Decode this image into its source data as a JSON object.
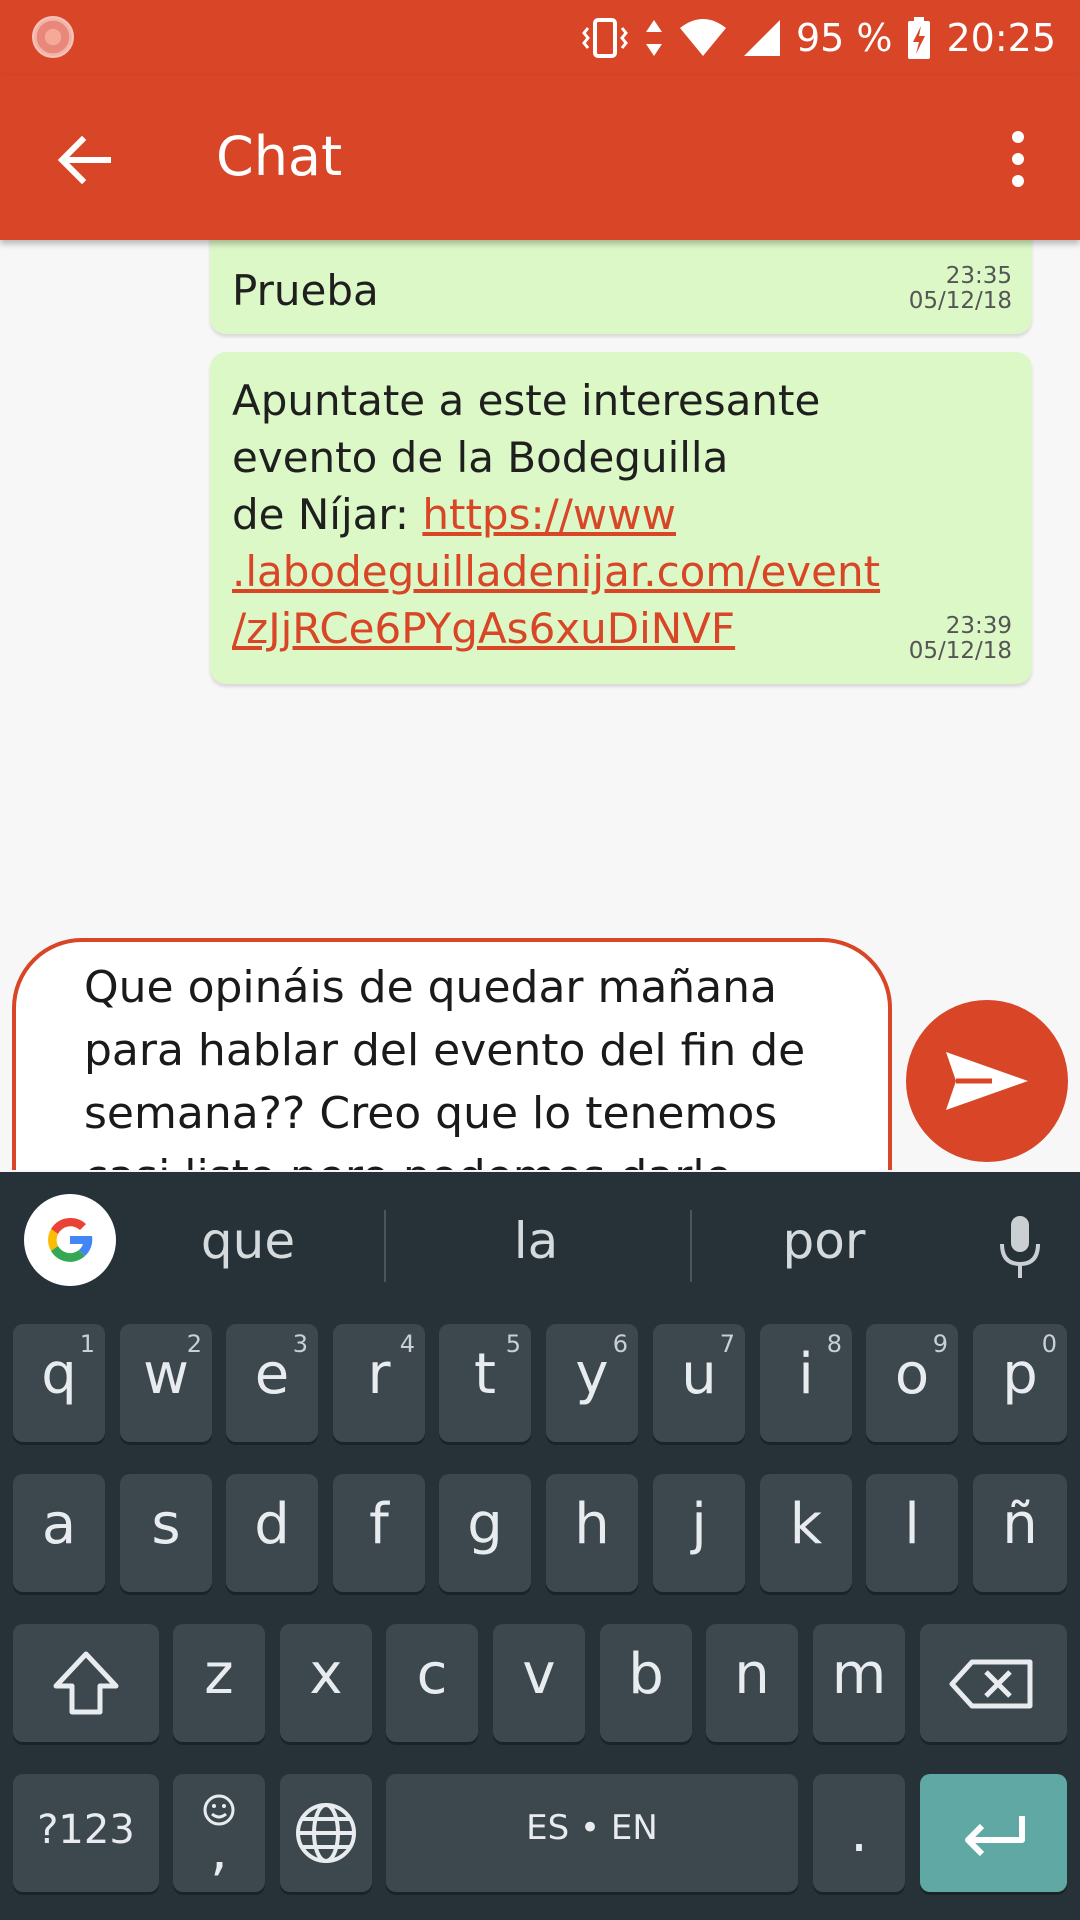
{
  "status_bar": {
    "battery": "95 %",
    "time": "20:25"
  },
  "app_bar": {
    "title": "Chat"
  },
  "messages": [
    {
      "text": "Prueba",
      "time": "23:35",
      "date": "05/12/18"
    },
    {
      "text_prefix_line1": "Apuntate a este interesante",
      "text_prefix_line2": "evento de la Bodeguilla",
      "text_prefix_line3": "de Níjar: ",
      "link_line1": "https://www",
      "link_line2": ".labodeguilladenijar.com/event",
      "link_line3": "/zJjRCe6PYgAs6xuDiNVF",
      "time": "23:39",
      "date": "05/12/18"
    }
  ],
  "compose": {
    "text": "Que opináis de quedar mañana para hablar del evento del fin de semana?? Creo que lo tenemos casi listo pero podemos darle unos últimos retoques y aprovechamos para ver alguna peli "
  },
  "keyboard": {
    "suggestions": [
      "que",
      "la",
      "por"
    ],
    "row1": [
      {
        "k": "q",
        "h": "1"
      },
      {
        "k": "w",
        "h": "2"
      },
      {
        "k": "e",
        "h": "3"
      },
      {
        "k": "r",
        "h": "4"
      },
      {
        "k": "t",
        "h": "5"
      },
      {
        "k": "y",
        "h": "6"
      },
      {
        "k": "u",
        "h": "7"
      },
      {
        "k": "i",
        "h": "8"
      },
      {
        "k": "o",
        "h": "9"
      },
      {
        "k": "p",
        "h": "0"
      }
    ],
    "row2": [
      "a",
      "s",
      "d",
      "f",
      "g",
      "h",
      "j",
      "k",
      "l",
      "ñ"
    ],
    "row3": [
      "z",
      "x",
      "c",
      "v",
      "b",
      "n",
      "m"
    ],
    "symbols_label": "?123",
    "comma_label": ",",
    "space_label": "ES • EN",
    "period_label": "."
  },
  "colors": {
    "accent": "#d84527",
    "bubble": "#dcf8c6",
    "keyboard_bg": "#263238",
    "key_bg": "#3c474e",
    "enter_key": "#5fa8a4"
  }
}
